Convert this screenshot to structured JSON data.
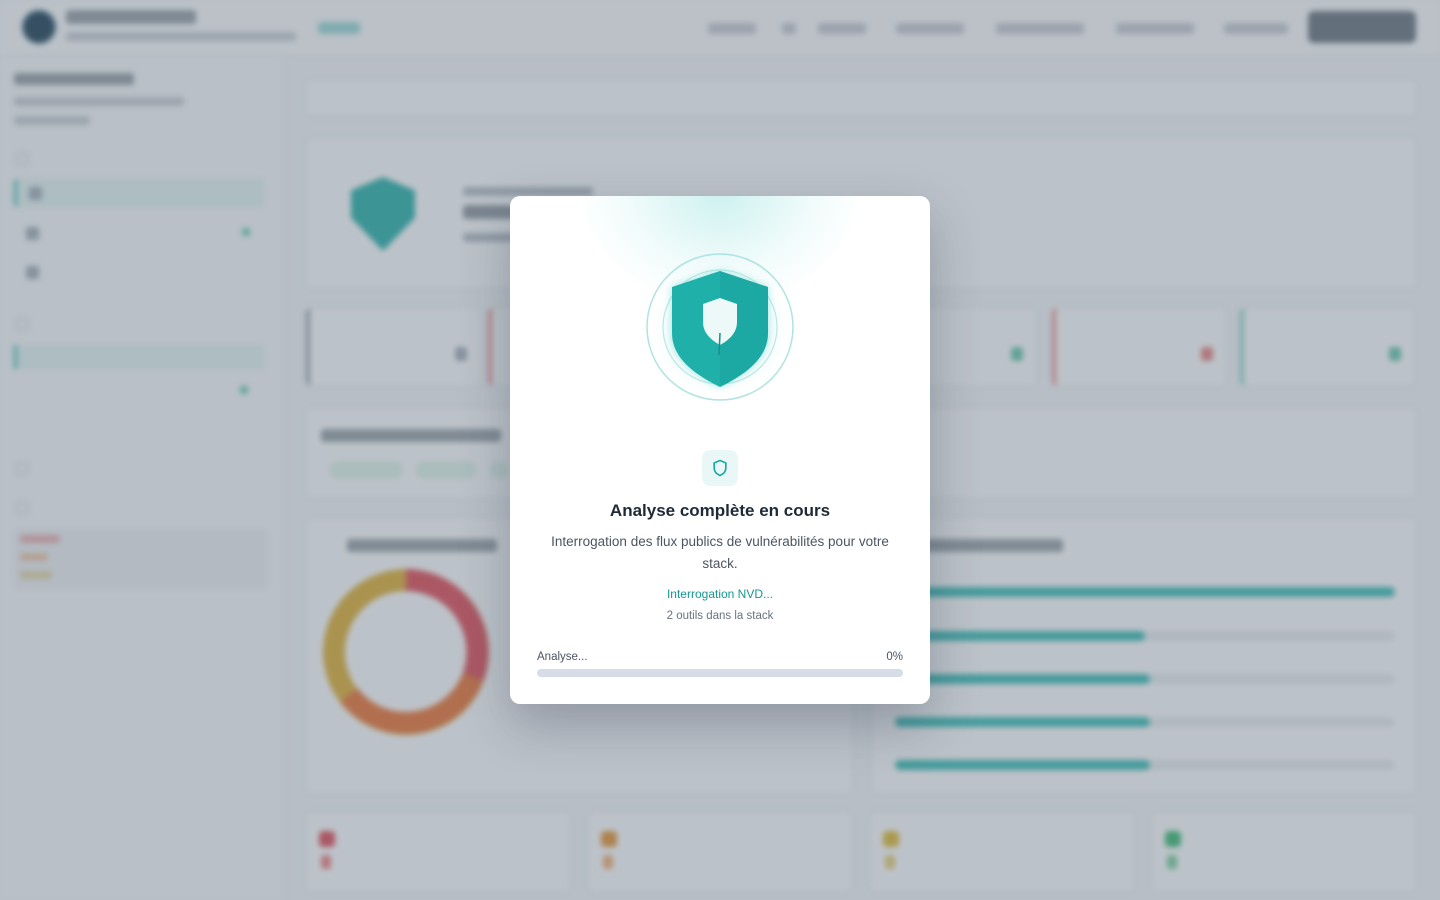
{
  "modal": {
    "title": "Analyse complète en cours",
    "description": "Interrogation des flux publics de vulnérabilités pour votre stack.",
    "status": "Interrogation NVD...",
    "tool_count": "2 outils dans la stack",
    "progress_label": "Analyse...",
    "progress_percent_text": "0%",
    "progress_value": 0,
    "icons": [
      "shield-emblem-icon",
      "shield-outline-icon"
    ]
  },
  "background": {
    "note": "Dashboard behind modal is blurred; text not legible in screenshot."
  },
  "colors": {
    "accent": "#1ba9a3",
    "accent_light": "#e9f8f7",
    "progress_track": "#d6dde6",
    "overlay": "rgba(108,118,132,0.42)"
  }
}
